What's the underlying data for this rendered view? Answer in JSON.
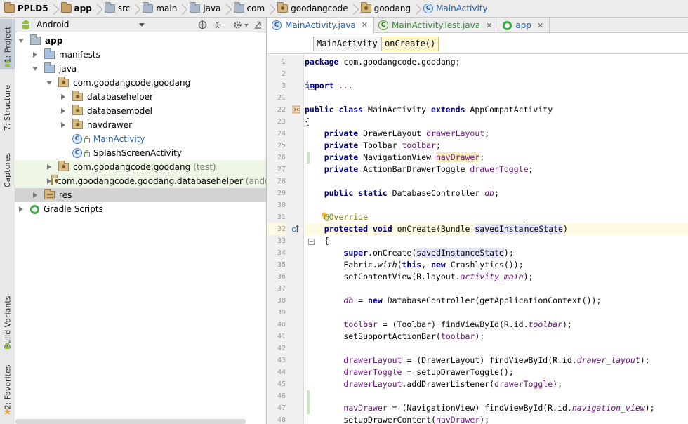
{
  "breadcrumb": {
    "items": [
      {
        "label": "PPLD5",
        "icon": "module-folder-icon",
        "bold": true
      },
      {
        "label": "app",
        "icon": "module-folder-icon",
        "bold": true
      },
      {
        "label": "src",
        "icon": "folder-icon"
      },
      {
        "label": "main",
        "icon": "folder-icon"
      },
      {
        "label": "java",
        "icon": "source-folder-icon"
      },
      {
        "label": "com",
        "icon": "folder-icon"
      },
      {
        "label": "goodangcode",
        "icon": "package-icon"
      },
      {
        "label": "goodang",
        "icon": "package-icon"
      },
      {
        "label": "MainActivity",
        "icon": "class-icon"
      }
    ]
  },
  "left_stripe": {
    "project": "1: Project",
    "structure": "7: Structure",
    "captures": "Captures",
    "build_variants": "Build Variants",
    "favorites": "2: Favorites"
  },
  "project_panel": {
    "view_mode": "Android",
    "tree": [
      {
        "label": "app",
        "bold": true,
        "expanded": true,
        "level": 0,
        "icon": "module-folder-icon"
      },
      {
        "label": "manifests",
        "expanded": false,
        "level": 1,
        "icon": "source-folder-icon"
      },
      {
        "label": "java",
        "expanded": true,
        "level": 1,
        "icon": "source-folder-icon"
      },
      {
        "label": "com.goodangcode.goodang",
        "expanded": true,
        "level": 2,
        "icon": "package-icon"
      },
      {
        "label": "databasehelper",
        "expanded": false,
        "level": 3,
        "icon": "package-icon"
      },
      {
        "label": "databasemodel",
        "expanded": false,
        "level": 3,
        "icon": "package-icon"
      },
      {
        "label": "navdrawer",
        "expanded": false,
        "level": 3,
        "icon": "package-icon"
      },
      {
        "label": "MainActivity",
        "level": 3,
        "icon": "class-icon",
        "blue": true
      },
      {
        "label": "SplashScreenActivity",
        "level": 3,
        "icon": "class-icon"
      },
      {
        "label": "com.goodangcode.goodang",
        "suffix": "(test)",
        "expanded": false,
        "level": 2,
        "icon": "package-icon",
        "test": true
      },
      {
        "label": "com.goodangcode.goodang.databasehelper",
        "suffix": "(androi",
        "expanded": false,
        "level": 2,
        "icon": "package-icon",
        "test": true
      },
      {
        "label": "res",
        "expanded": false,
        "level": 1,
        "icon": "res-folder-icon",
        "selected": true
      },
      {
        "label": "Gradle Scripts",
        "expanded": false,
        "level": 0,
        "icon": "gradle-icon"
      }
    ]
  },
  "editor": {
    "tabs": [
      {
        "label": "MainActivity.java",
        "active": true,
        "color": "blue",
        "icon": "class-icon"
      },
      {
        "label": "MainActivityTest.java",
        "active": false,
        "color": "green",
        "icon": "test-class-icon"
      },
      {
        "label": "app",
        "active": false,
        "color": "blue",
        "icon": "gradle-icon"
      }
    ],
    "method_bar": [
      "MainActivity",
      "onCreate()"
    ],
    "line_numbers": [
      "1",
      "2",
      "3",
      "21",
      "22",
      "23",
      "24",
      "25",
      "26",
      "27",
      "28",
      "29",
      "30",
      "31",
      "32",
      "33",
      "34",
      "35",
      "36",
      "37",
      "38",
      "39",
      "40",
      "41",
      "42",
      "43",
      "44",
      "45",
      "46",
      "47",
      "48"
    ]
  },
  "code_lines": {
    "l1": [
      "package com.goodangcode.goodang;"
    ],
    "l3": [
      "import",
      " ..."
    ],
    "l22": [
      "public class",
      " MainActivity ",
      "extends",
      " AppCompatActivity"
    ],
    "l23": [
      "{"
    ],
    "l24": [
      "    ",
      "private",
      " DrawerLayout ",
      "drawerLayout",
      ";"
    ],
    "l25": [
      "    ",
      "private",
      " Toolbar ",
      "toolbar",
      ";"
    ],
    "l26": [
      "    ",
      "private",
      " NavigationView ",
      "navDrawer",
      ";"
    ],
    "l27": [
      "    ",
      "private",
      " ActionBarDrawerToggle ",
      "drawerToggle",
      ";"
    ],
    "l29": [
      "    ",
      "public static",
      " DatabaseController ",
      "db",
      ";"
    ],
    "l31": [
      "    ",
      "@Override"
    ],
    "l32": [
      "    ",
      "protected void",
      " onCreate(Bundle ",
      "savedInsta",
      "nceState",
      ")"
    ],
    "l33": [
      "    {"
    ],
    "l34": [
      "        ",
      "super",
      ".onCreate(",
      "savedInstanceState",
      ");"
    ],
    "l35": [
      "        Fabric.",
      "with",
      "(",
      "this",
      ", ",
      "new",
      " Crashlytics());"
    ],
    "l36": [
      "        setContentView(R.layout.",
      "activity_main",
      ");"
    ],
    "l38": [
      "        ",
      "db",
      " = ",
      "new",
      " DatabaseController(getApplicationContext());"
    ],
    "l40": [
      "        ",
      "toolbar",
      " = (Toolbar) findViewById(R.id.",
      "toolbar",
      ");"
    ],
    "l41": [
      "        setSupportActionBar(",
      "toolbar",
      ");"
    ],
    "l43": [
      "        ",
      "drawerLayout",
      " = (DrawerLayout) findViewById(R.id.",
      "drawer_layout",
      ");"
    ],
    "l44": [
      "        ",
      "drawerToggle",
      " = setupDrawerToggle();"
    ],
    "l45": [
      "        ",
      "drawerLayout",
      ".addDrawerListener(",
      "drawerToggle",
      ");"
    ],
    "l47": [
      "        ",
      "navDrawer",
      " = (NavigationView) findViewById(R.id.",
      "navigation_view",
      ");"
    ],
    "l48": [
      "        setupDrawerContent(",
      "navDrawer",
      ");"
    ]
  },
  "colors": {
    "keyword": "#000080",
    "field": "#660e7a",
    "annotation": "#808000",
    "current_line": "#fffae3",
    "class_link": "#1f5fb0"
  }
}
